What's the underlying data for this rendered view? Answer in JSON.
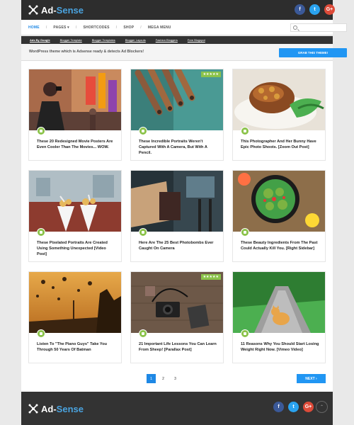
{
  "brand": {
    "name_part1": "Ad-",
    "name_part2": "Sense"
  },
  "social": {
    "facebook": "f",
    "twitter": "t",
    "google": "G+"
  },
  "nav": {
    "items": [
      "HOME",
      "PAGES ▾",
      "SHORTCODES",
      "SHOP",
      "MEGA MENU"
    ],
    "search_placeholder": ""
  },
  "subnav": [
    "Ads By Google",
    "Blogger Template",
    "Blogger Templates",
    "Blogger Layouts",
    "Fashion Bloggers",
    "Free Blogspot"
  ],
  "promo": {
    "text": "WordPress theme which is Adsense ready & detects Ad Blockers!",
    "button": "GRAB THIS THEME!"
  },
  "stars": "★★★★★",
  "posts": [
    {
      "title": "These 20 Redesigned Movie Posters Are Even Cooler Than The Movies... WOW."
    },
    {
      "title": "These Incredible Portraits Weren't Captured With A Camera, But With A Pencil."
    },
    {
      "title": "This Photographer And Her Bunny Have Epic Photo Shoots. [Zoom Out Post]"
    },
    {
      "title": "These Pixelated Portraits Are Created Using Something Unexpected [Video Post]"
    },
    {
      "title": "Here Are The 25 Best Photobombs Ever Caught On Camera"
    },
    {
      "title": "These Beauty Ingredients From The Past Could Actually Kill You. [Right Sidebar]"
    },
    {
      "title": "Listen To \"The Piano Guys\" Take You Through 50 Years Of Batman"
    },
    {
      "title": "21 Important Life Lessons You Can Learn From Sheep! [Parallax Post]"
    },
    {
      "title": "11 Reasons Why You Should Start Losing Weight Right Now. [Vimeo Video]"
    }
  ],
  "pagination": {
    "pages": [
      "1",
      "2",
      "3"
    ],
    "next": "NEXT ›"
  },
  "footer": {
    "scroll_top": "⌃"
  },
  "colors": {
    "accent": "#2196f3",
    "badge": "#8bc34a",
    "dark": "#2d2d2d"
  }
}
